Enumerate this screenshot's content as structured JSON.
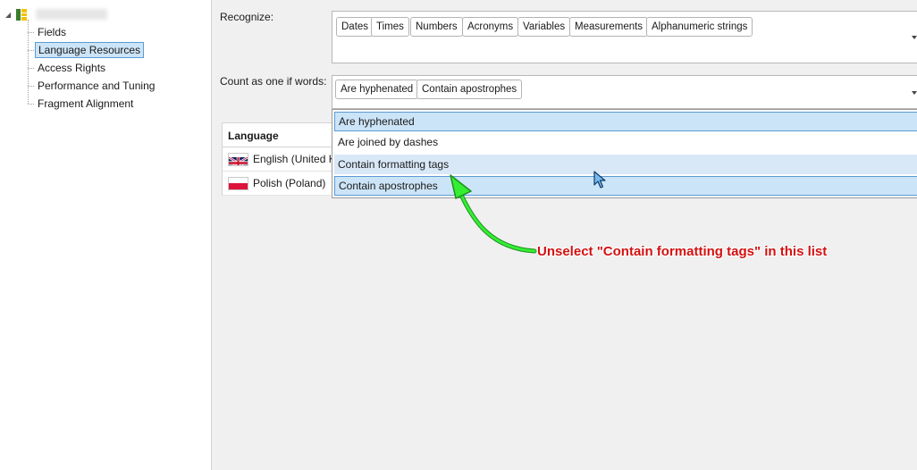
{
  "tree": {
    "items": [
      {
        "label": "Fields"
      },
      {
        "label": "Language Resources"
      },
      {
        "label": "Access Rights"
      },
      {
        "label": "Performance and Tuning"
      },
      {
        "label": "Fragment Alignment"
      }
    ]
  },
  "recognize": {
    "label": "Recognize:",
    "tags": [
      "Dates",
      "Times",
      "Numbers",
      "Acronyms",
      "Variables",
      "Measurements",
      "Alphanumeric strings"
    ]
  },
  "count": {
    "label": "Count as one if words:",
    "tags": [
      "Are hyphenated",
      "Contain apostrophes"
    ],
    "options": [
      "Are hyphenated",
      "Are joined by dashes",
      "Contain formatting tags",
      "Contain apostrophes"
    ]
  },
  "languages": {
    "header": "Language",
    "rows": [
      "English (United Ki",
      "Polish (Poland)"
    ]
  },
  "annotation": "Unselect \"Contain formatting tags\" in this list",
  "colors": {
    "annotation": "#d31010",
    "arrow": "#22dd22",
    "selection": "#cce4f7"
  }
}
